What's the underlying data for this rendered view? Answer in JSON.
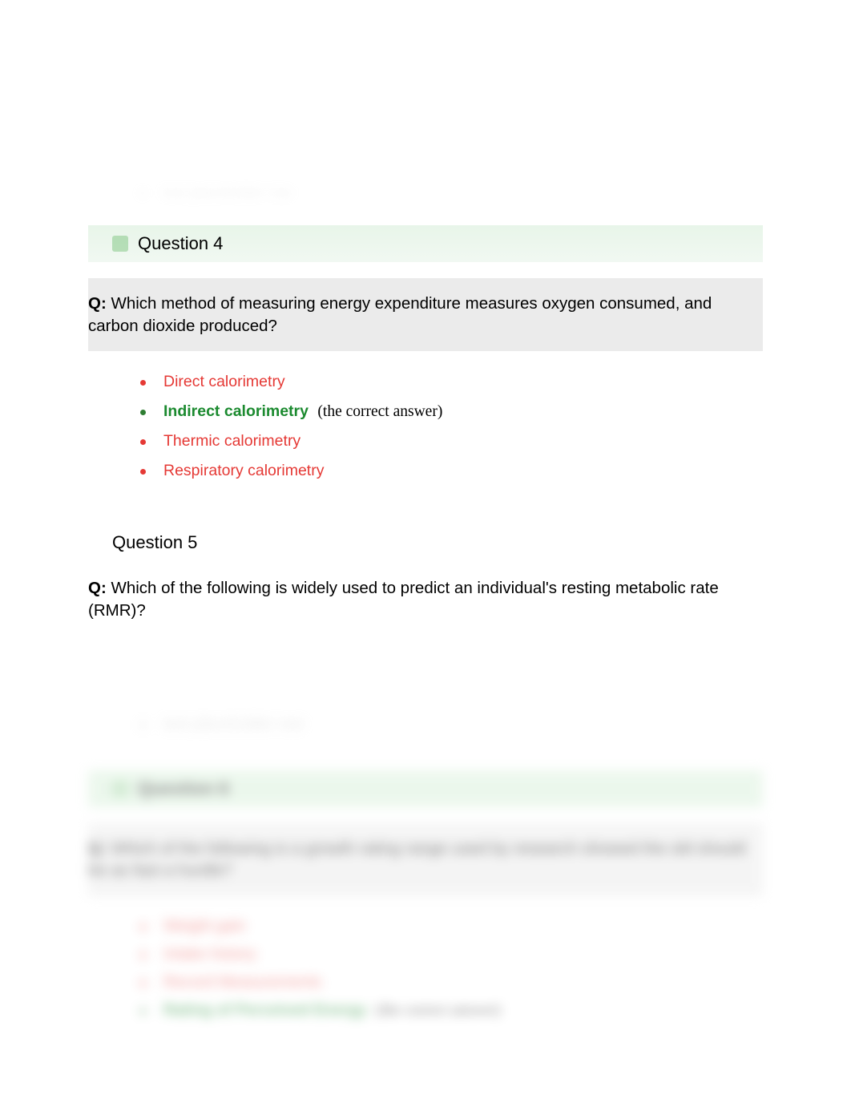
{
  "blurred_top_item": "text placeholder row",
  "q4": {
    "header": "Question 4",
    "prefix": "Q:",
    "text": "Which method of measuring energy expenditure measures oxygen consumed, and carbon dioxide produced?",
    "answers": [
      {
        "label": "Direct calorimetry",
        "correct": false
      },
      {
        "label": "Indirect calorimetry",
        "correct": true,
        "note": "(the correct answer)"
      },
      {
        "label": "Thermic calorimetry",
        "correct": false
      },
      {
        "label": "Respiratory calorimetry",
        "correct": false
      }
    ]
  },
  "q5": {
    "header": "Question 5",
    "prefix": "Q:",
    "text": "Which of the following is widely used to predict an individual's resting metabolic rate (RMR)?"
  },
  "blurred_mid_item": "text placeholder row",
  "q6": {
    "header": "Question 6",
    "prefix": "Q:",
    "text": "Which of the following is a growth rating range used by research showed the old should be as fast a hurdle?",
    "answers": [
      {
        "label": "Weight gain",
        "correct": false
      },
      {
        "label": "Intake history",
        "correct": false
      },
      {
        "label": "Record Measurements",
        "correct": false
      },
      {
        "label": "Rating of Perceived Energy",
        "correct": true,
        "note": "(the correct answer)"
      }
    ]
  }
}
